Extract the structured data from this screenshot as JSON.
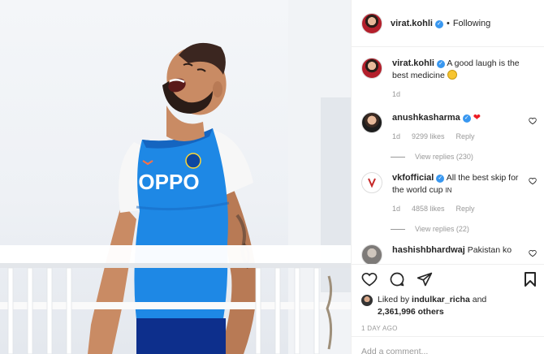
{
  "header": {
    "username": "virat.kohli",
    "separator": "•",
    "follow_status": "Following"
  },
  "caption": {
    "username": "virat.kohli",
    "text": "A good laugh is the best medicine",
    "age": "1d"
  },
  "comments": [
    {
      "username": "anushkasharma",
      "text": "",
      "age": "1d",
      "likes": "9299 likes",
      "reply_label": "Reply",
      "view_replies": "View replies (230)"
    },
    {
      "username": "vkfofficial",
      "text": "All the best skip for the world cup",
      "flag_text": "IN",
      "age": "1d",
      "likes": "4858 likes",
      "reply_label": "Reply",
      "view_replies": "View replies (22)"
    },
    {
      "username": "hashishbhardwaj",
      "text": "Pakistan ko"
    }
  ],
  "likes": {
    "prefix": "Liked by",
    "user": "indulkar_richa",
    "conjunction": "and",
    "count": "2,361,996 others"
  },
  "time_ago": "1 DAY AGO",
  "add_comment": {
    "placeholder": "Add a comment..."
  },
  "photo": {
    "jersey_text": "OPPO"
  },
  "colors": {
    "verified": "#3897f0",
    "jersey": "#1e88e5",
    "heart": "#ed1c24"
  }
}
